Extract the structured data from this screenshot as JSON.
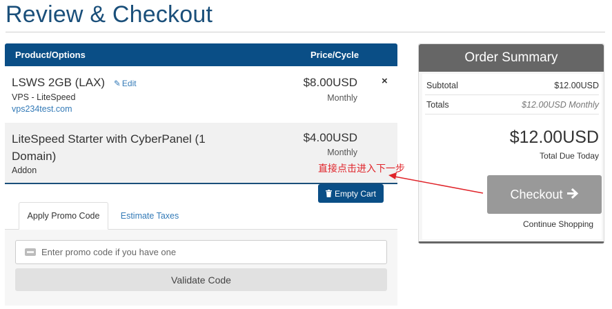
{
  "page": {
    "title": "Review & Checkout"
  },
  "cart": {
    "headers": {
      "product": "Product/Options",
      "price": "Price/Cycle"
    },
    "items": [
      {
        "name": "LSWS 2GB (LAX)",
        "edit_label": "Edit",
        "subtitle": "VPS - LiteSpeed",
        "domain": "vps234test.com",
        "price": "$8.00USD",
        "cycle": "Monthly",
        "remove_icon": "×"
      },
      {
        "name": "LiteSpeed Starter with CyberPanel (1 Domain)",
        "subtitle": "Addon",
        "price": "$4.00USD",
        "cycle": "Monthly"
      }
    ],
    "empty_cart_label": "Empty Cart"
  },
  "annotation": {
    "text": "直接点击进入下一步",
    "color": "#e0242a"
  },
  "tabs": [
    {
      "label": "Apply Promo Code",
      "active": true
    },
    {
      "label": "Estimate Taxes",
      "active": false
    }
  ],
  "promo": {
    "placeholder": "Enter promo code if you have one",
    "validate_label": "Validate Code"
  },
  "summary": {
    "title": "Order Summary",
    "subtotal_label": "Subtotal",
    "subtotal_value": "$12.00USD",
    "totals_label": "Totals",
    "totals_value": "$12.00USD Monthly",
    "total_due": "$12.00USD",
    "total_due_label": "Total Due Today",
    "checkout_label": "Checkout",
    "continue_label": "Continue Shopping"
  },
  "colors": {
    "brand_blue": "#0a4e86",
    "title_blue": "#1a4f7a",
    "link_blue": "#337ab7",
    "summary_gray": "#666666",
    "checkout_gray": "#999999"
  },
  "icons": {
    "edit": "pencil-icon",
    "remove": "close-icon",
    "empty_cart": "trash-icon",
    "promo": "ticket-icon",
    "checkout": "arrow-right-icon"
  }
}
